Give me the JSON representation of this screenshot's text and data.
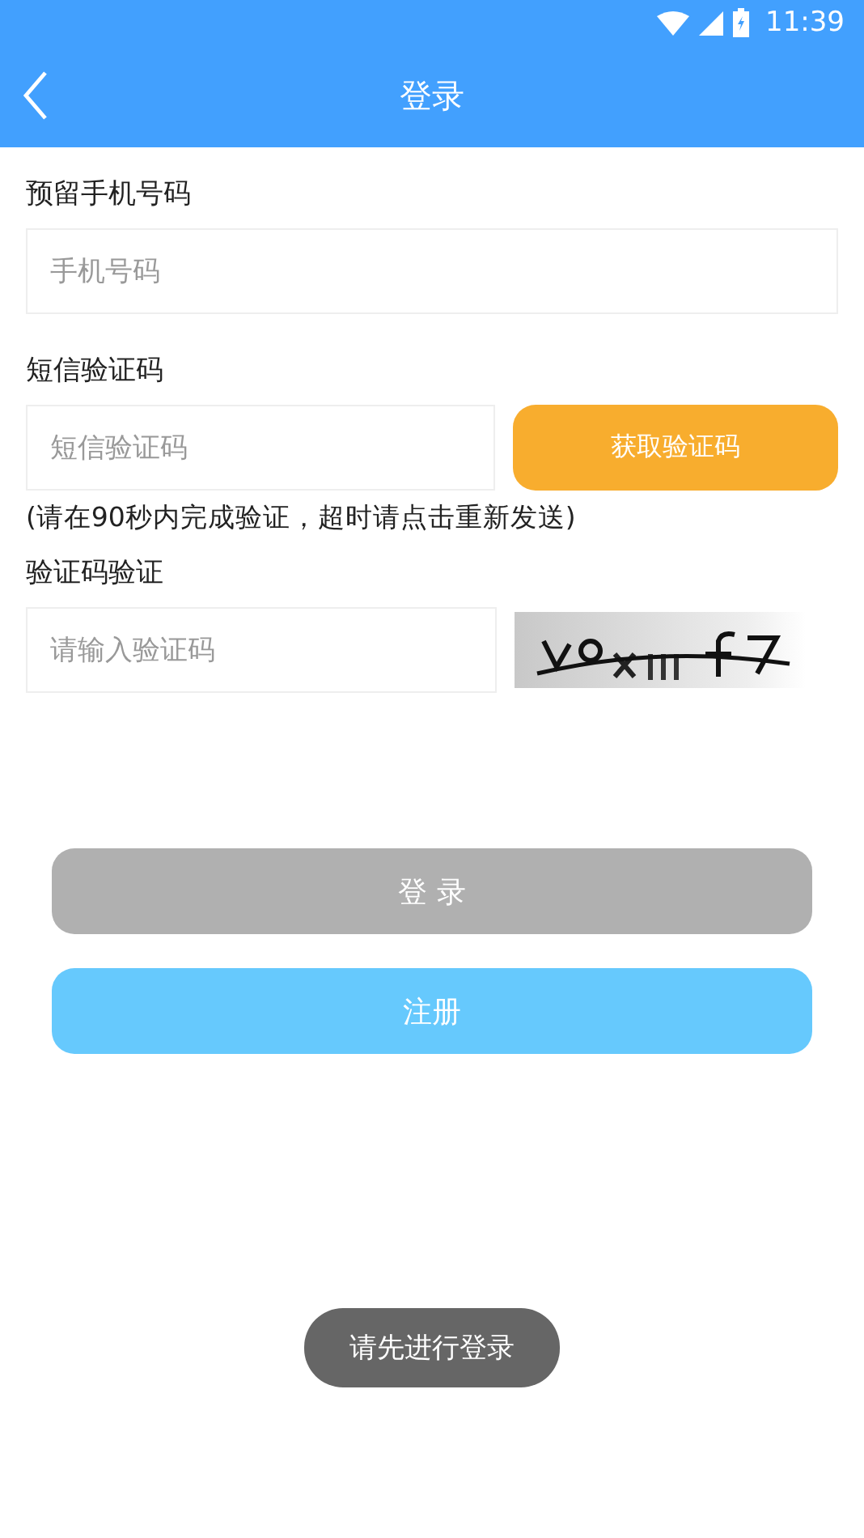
{
  "status_bar": {
    "time": "11:39"
  },
  "header": {
    "title": "登录"
  },
  "phone": {
    "label": "预留手机号码",
    "placeholder": "手机号码"
  },
  "sms": {
    "label": "短信验证码",
    "placeholder": "短信验证码",
    "button": "获取验证码",
    "hint": "(请在90秒内完成验证，超时请点击重新发送)"
  },
  "captcha": {
    "label": "验证码验证",
    "placeholder": "请输入验证码"
  },
  "buttons": [
    {
      "label": "登 录",
      "disabled": true
    },
    {
      "label": "注册",
      "disabled": false
    }
  ],
  "toast": "请先进行登录"
}
